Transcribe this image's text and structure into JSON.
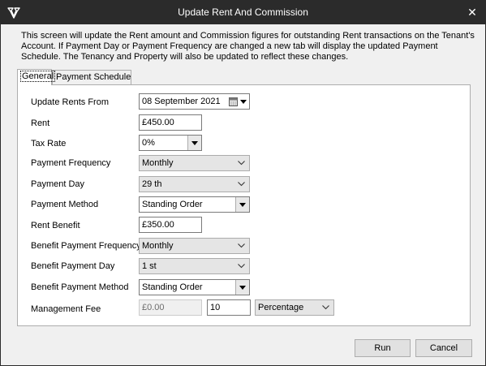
{
  "window": {
    "title": "Update Rent And Commission",
    "close_glyph": "✕",
    "app_icon": "app-logo-icon"
  },
  "description": "This screen will update the Rent amount and Commission figures for outstanding Rent transactions on the Tenant's Account. If Payment Day or Payment Frequency are changed a new tab will display the updated Payment Schedule. The Tenancy and Property will also be updated to reflect these changes.",
  "tabs": [
    {
      "label": "General",
      "active": true
    },
    {
      "label": "Payment Schedule",
      "active": false
    }
  ],
  "form": {
    "update_rents_from": {
      "label": "Update Rents From",
      "value": "08 September 2021"
    },
    "rent": {
      "label": "Rent",
      "value": "£450.00"
    },
    "tax_rate": {
      "label": "Tax Rate",
      "value": "0%"
    },
    "payment_frequency": {
      "label": "Payment Frequency",
      "value": "Monthly"
    },
    "payment_day": {
      "label": "Payment Day",
      "value": "29 th"
    },
    "payment_method": {
      "label": "Payment Method",
      "value": "Standing Order"
    },
    "rent_benefit": {
      "label": "Rent Benefit",
      "value": "£350.00"
    },
    "benefit_payment_frequency": {
      "label": "Benefit Payment Frequency",
      "value": "Monthly"
    },
    "benefit_payment_day": {
      "label": "Benefit Payment Day",
      "value": "1 st"
    },
    "benefit_payment_method": {
      "label": "Benefit Payment Method",
      "value": "Standing Order"
    },
    "management_fee": {
      "label": "Management Fee",
      "amount": "£0.00",
      "value": "10",
      "type": "Percentage"
    }
  },
  "buttons": {
    "run": "Run",
    "cancel": "Cancel"
  }
}
